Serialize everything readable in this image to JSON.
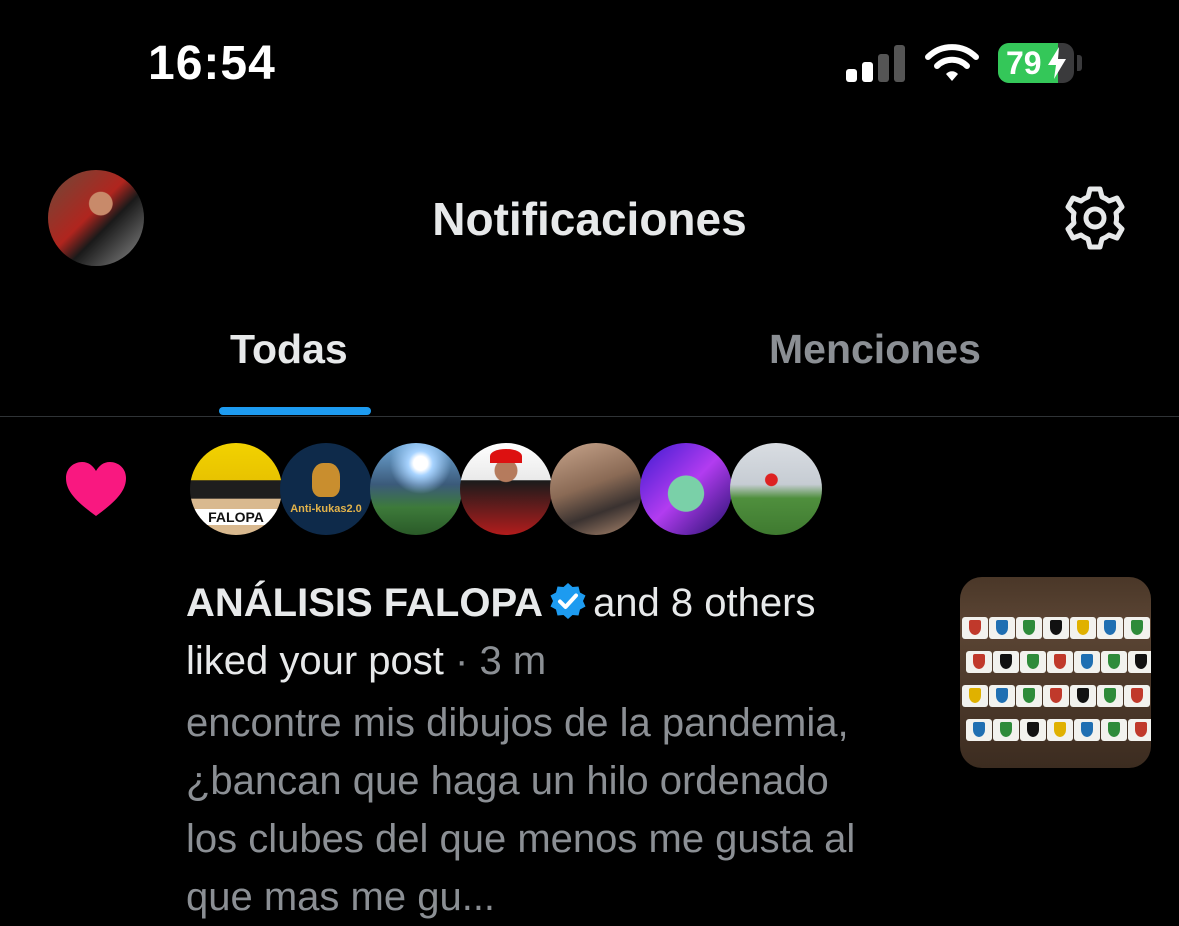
{
  "status_bar": {
    "time": "16:54",
    "battery_percent": "79",
    "battery_level": 0.79,
    "battery_color": "#34c759",
    "signal_bars_active": 2,
    "wifi_icon": "wifi-icon"
  },
  "header": {
    "title": "Notificaciones",
    "settings_icon": "gear-icon"
  },
  "tabs": [
    {
      "label": "Todas",
      "selected": true
    },
    {
      "label": "Menciones",
      "selected": false
    }
  ],
  "accent_color": "#1d9bf0",
  "notification": {
    "type_icon": "heart-icon",
    "type_color": "#f91880",
    "liker_avatar_labels": [
      "FALOPA",
      "Anti-kukas2.0"
    ],
    "actor_name": "ANÁLISIS FALOPA",
    "actor_verified": true,
    "others_text": "and 8 others",
    "action_text": "liked your post",
    "separator": "·",
    "time_ago": "3 m",
    "post_excerpt": "encontre mis dibujos de la pandemia, ¿bancan que haga un hilo ordenado los clubes del que menos me gusta al que mas me gu..."
  }
}
